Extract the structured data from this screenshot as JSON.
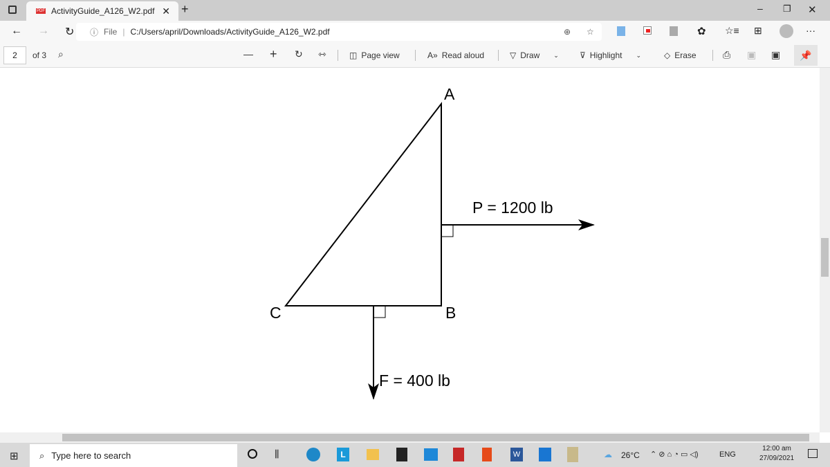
{
  "browser": {
    "tab_title": "ActivityGuide_A126_W2.pdf",
    "url_prefix": "File",
    "url": "C:/Users/april/Downloads/ActivityGuide_A126_W2.pdf"
  },
  "pdf_toolbar": {
    "page": "2",
    "of": "of 3",
    "page_view": "Page view",
    "read_aloud": "Read aloud",
    "draw": "Draw",
    "highlight": "Highlight",
    "erase": "Erase"
  },
  "diagram": {
    "A": "A",
    "B": "B",
    "C": "C",
    "P": "P = 1200 lb",
    "F": "F = 400 lb"
  },
  "taskbar": {
    "search_placeholder": "Type here to search",
    "temp": "26°C",
    "lang": "ENG",
    "time": "12:00 am",
    "date": "27/09/2021"
  }
}
